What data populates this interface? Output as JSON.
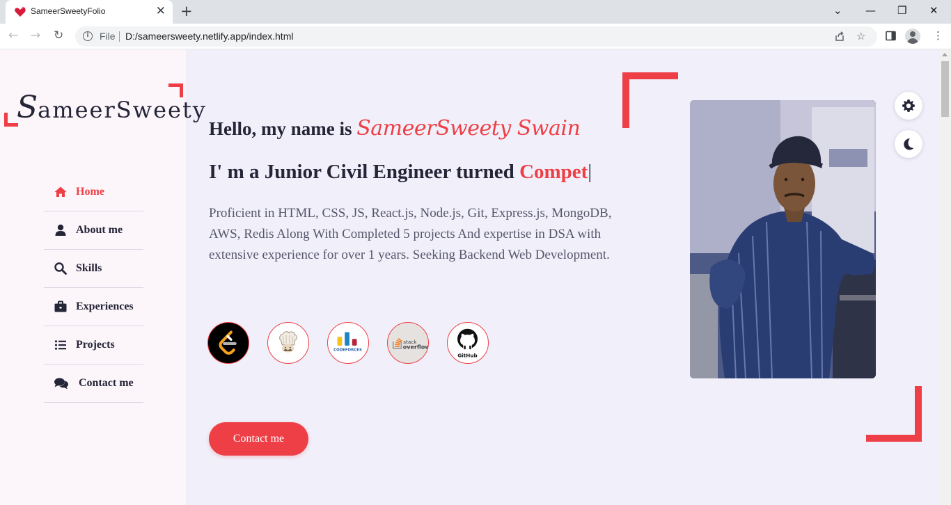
{
  "browser": {
    "tab_title": "SameerSweetyFolio",
    "tab_close": "✕",
    "new_tab": "+",
    "window_controls": {
      "minimize": "—",
      "restore": "❐",
      "close": "✕",
      "tab_search": "⌄"
    },
    "nav": {
      "back": "←",
      "forward": "→",
      "reload": "↻"
    },
    "omnibox": {
      "scheme_label": "File",
      "url": "D:/sameersweety.netlify.app/index.html",
      "info": "i"
    },
    "icons": {
      "share": "share-icon",
      "bookmark": "☆",
      "side_panel": "side-panel-icon",
      "menu": "⋮"
    }
  },
  "sidebar": {
    "logo": {
      "first": "S",
      "rest": "ameerSweety"
    },
    "items": [
      {
        "label": "Home",
        "icon": "home-icon",
        "active": true
      },
      {
        "label": "About me",
        "icon": "user-icon",
        "active": false
      },
      {
        "label": "Skills",
        "icon": "search-icon",
        "active": false
      },
      {
        "label": "Experiences",
        "icon": "briefcase-icon",
        "active": false
      },
      {
        "label": "Projects",
        "icon": "list-icon",
        "active": false
      },
      {
        "label": "Contact me",
        "icon": "comments-icon",
        "active": false
      }
    ]
  },
  "hero": {
    "greeting": "Hello, my name is ",
    "name": "SameerSweety Swain",
    "role_prefix": "I' m a Junior Civil Engineer turned ",
    "role_typed": "Compet",
    "cursor": "|",
    "about": "Proficient in HTML, CSS, JS, React.js, Node.js, Git, Express.js, MongoDB, AWS, Redis Along With Completed 5 projects And expertise in DSA with extensive experience for over 1 years. Seeking Backend Web Development.",
    "socials": [
      {
        "name": "LeetCode",
        "icon": "leetcode-icon"
      },
      {
        "name": "CodeChef",
        "icon": "codechef-icon"
      },
      {
        "name": "Codeforces",
        "icon": "codeforces-icon",
        "text": "CODEFORCES"
      },
      {
        "name": "Stack Overflow",
        "icon": "stackoverflow-icon",
        "text_top": "stack",
        "text_bottom": "overflow"
      },
      {
        "name": "GitHub",
        "icon": "github-icon",
        "text": "GitHub"
      }
    ],
    "cta_label": "Contact me"
  },
  "controls": {
    "settings_icon": "gear-icon",
    "theme_icon": "moon-icon"
  },
  "colors": {
    "accent": "#ee3f46",
    "text": "#252538",
    "body": "#55566a",
    "page_bg": "#f1f0fa",
    "sidebar_bg": "#fcf6fb"
  }
}
